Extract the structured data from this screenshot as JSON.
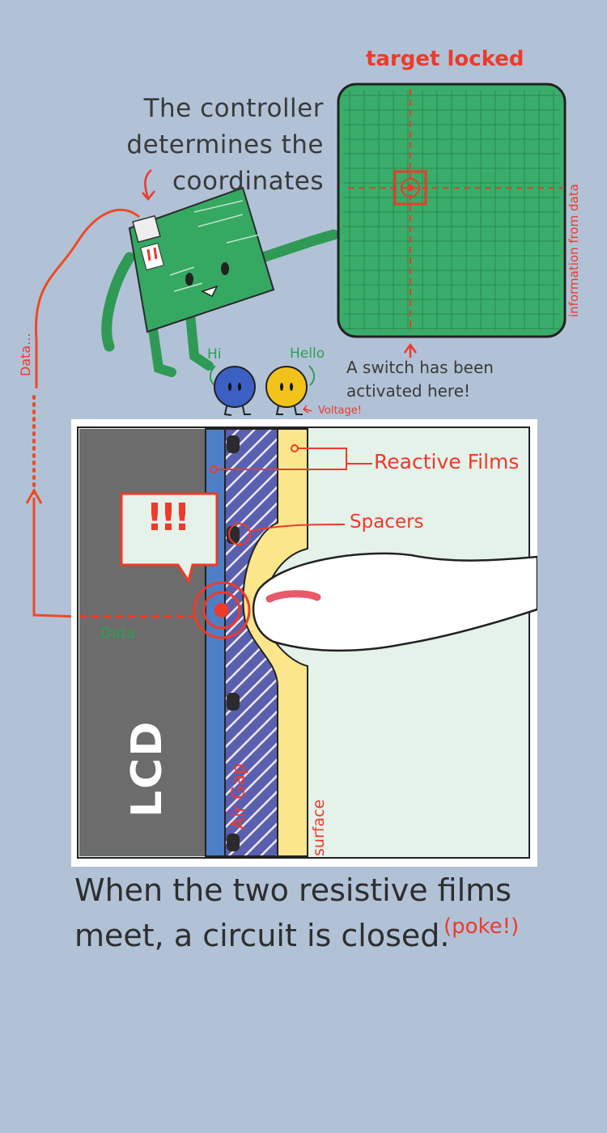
{
  "controller_text_line1": "The controller",
  "controller_text_line2": "determines the",
  "controller_text_line3": "coordinates",
  "target_label": "target locked",
  "side_label": "information from data",
  "switch_text_line1": "A switch has been",
  "switch_text_line2": "activated here!",
  "data_vertical_label": "Data...",
  "greeting_hi": "Hi",
  "greeting_hello": "Hello",
  "voltage_label": "Voltage!",
  "reactive_films_label": "Reactive Films",
  "spacers_label": "Spacers",
  "alert_text": "!!!",
  "data_small_label": "Data",
  "lcd_label": "LCD",
  "airgap_label": "Air Gap",
  "surface_label": "surface",
  "bottom_text_line1": "When the two resistive films",
  "bottom_text_line2": "meet, a circuit is closed.",
  "poke_label": "(poke!)",
  "colors": {
    "background": "#b1c2d7",
    "annotation_red": "#ee3a2a",
    "board_green": "#35a862",
    "screen_green": "#3aad6a",
    "lcd_gray": "#6c6c6c",
    "film_blue": "#4e7fc4",
    "airgap_purple": "#5b5fb0",
    "surface_yellow": "#fbe68c",
    "outside_mint": "#e4f2ea"
  }
}
